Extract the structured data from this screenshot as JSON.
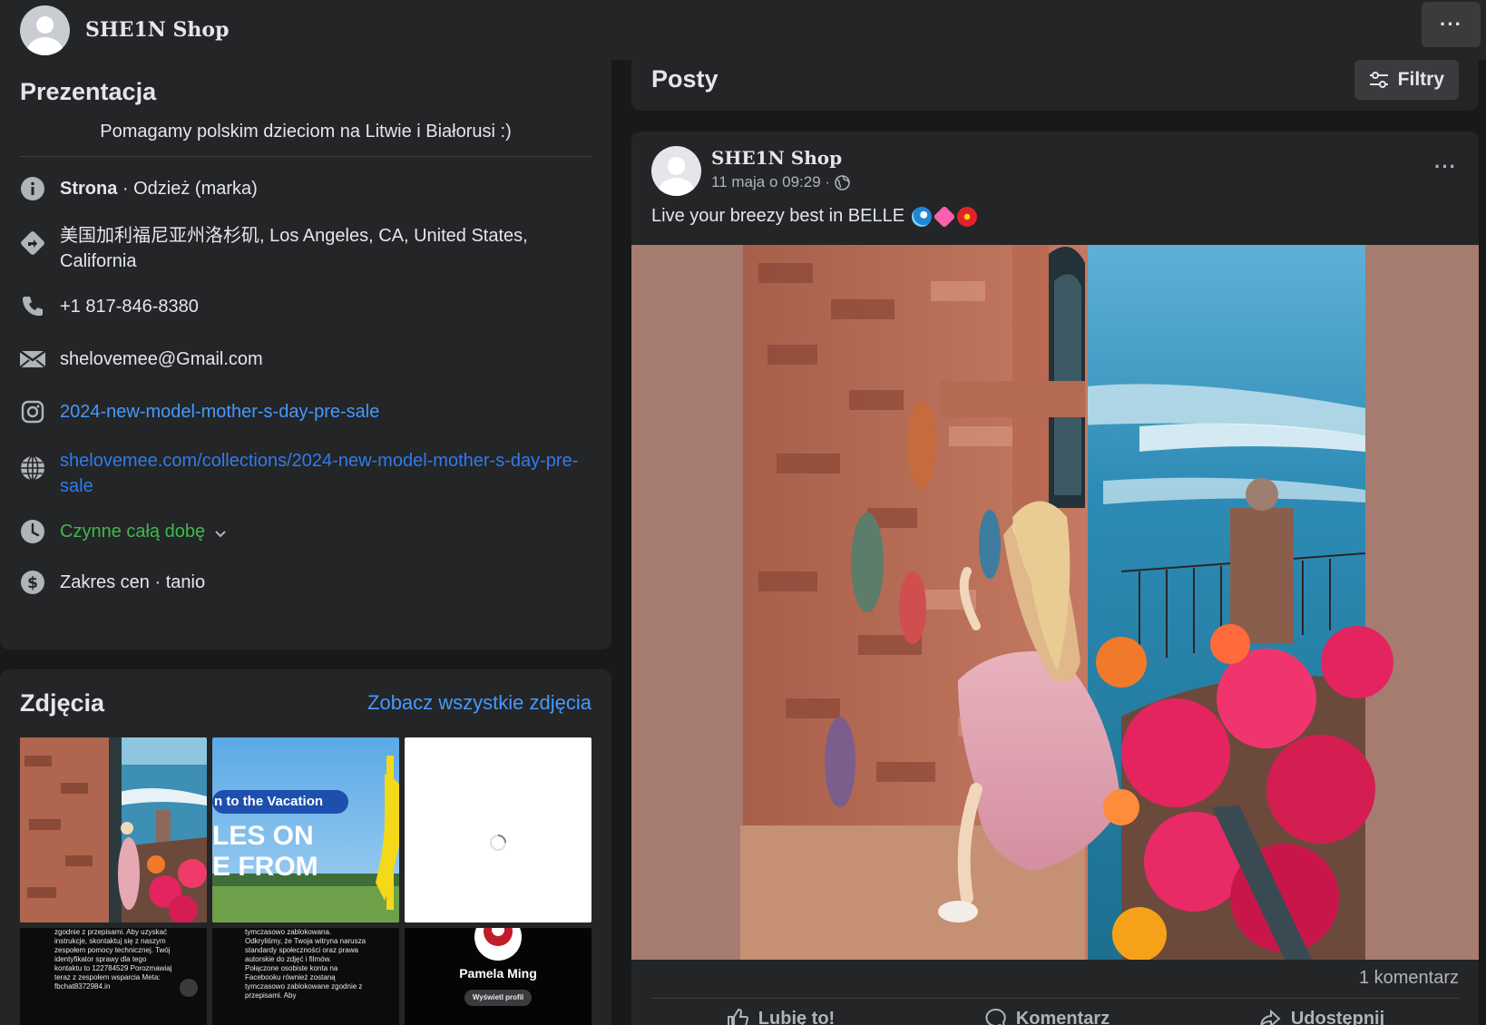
{
  "header": {
    "page_name": "SHE1N Shop",
    "more_label": "···"
  },
  "intro": {
    "title": "Prezentacja",
    "bio": "Pomagamy polskim dzieciom na Litwie i Białorusi :)",
    "category_label": "Strona",
    "category_value": " · Odzież (marka)",
    "address": "美国加利福尼亚州洛杉矶, Los Angeles, CA, United States, California",
    "phone": "+1 817-846-8380",
    "email": "shelovemee@Gmail.com",
    "instagram": "2024-new-model-mother-s-day-pre-sale",
    "website": "shelovemee.com/collections/2024-new-model-mother-s-day-pre-sale",
    "hours": "Czynne całą dobę",
    "price": "Zakres cen · tanio"
  },
  "photos": {
    "title": "Zdjęcia",
    "see_all": "Zobacz wszystkie zdjęcia",
    "thumb2_line1": "n to the Vacation",
    "thumb2_line2": "LES ON",
    "thumb2_line3": "E FROM",
    "thumb4_text": "zgodnie z przepisami. Aby uzyskać instrukcje, skontaktuj się z naszym zespołem pomocy technicznej. Twój identyfikator sprawy dla tego kontaktu to 122784529 Porozmawiaj teraz z zespołem wsparcia Meta: fbchat8372984.in",
    "thumb5_text": "tymczasowo zablokowana. Odkryliśmy, że Twoja witryna narusza standardy społeczności oraz prawa autorskie do zdjęć i filmów. Połączone osobiste konta na Facebooku również zostaną tymczasowo zablokowane zgodnie z przepisami. Aby",
    "thumb6_name": "Pamela Ming",
    "thumb6_button": "Wyświetl profil"
  },
  "posts": {
    "title": "Posty",
    "filters_label": "Filtry"
  },
  "post": {
    "author": "SHE1N Shop",
    "time": "11 maja o 09:29 ·",
    "text": "Live your breezy best in BELLE",
    "comments": "1 komentarz",
    "like_label": "Lubię to!",
    "comment_label": "Komentarz",
    "share_label": "Udostępnij"
  },
  "colors": {
    "background": "#18191a",
    "card": "#242526",
    "link": "#4599ff",
    "open_green": "#3fb950"
  }
}
